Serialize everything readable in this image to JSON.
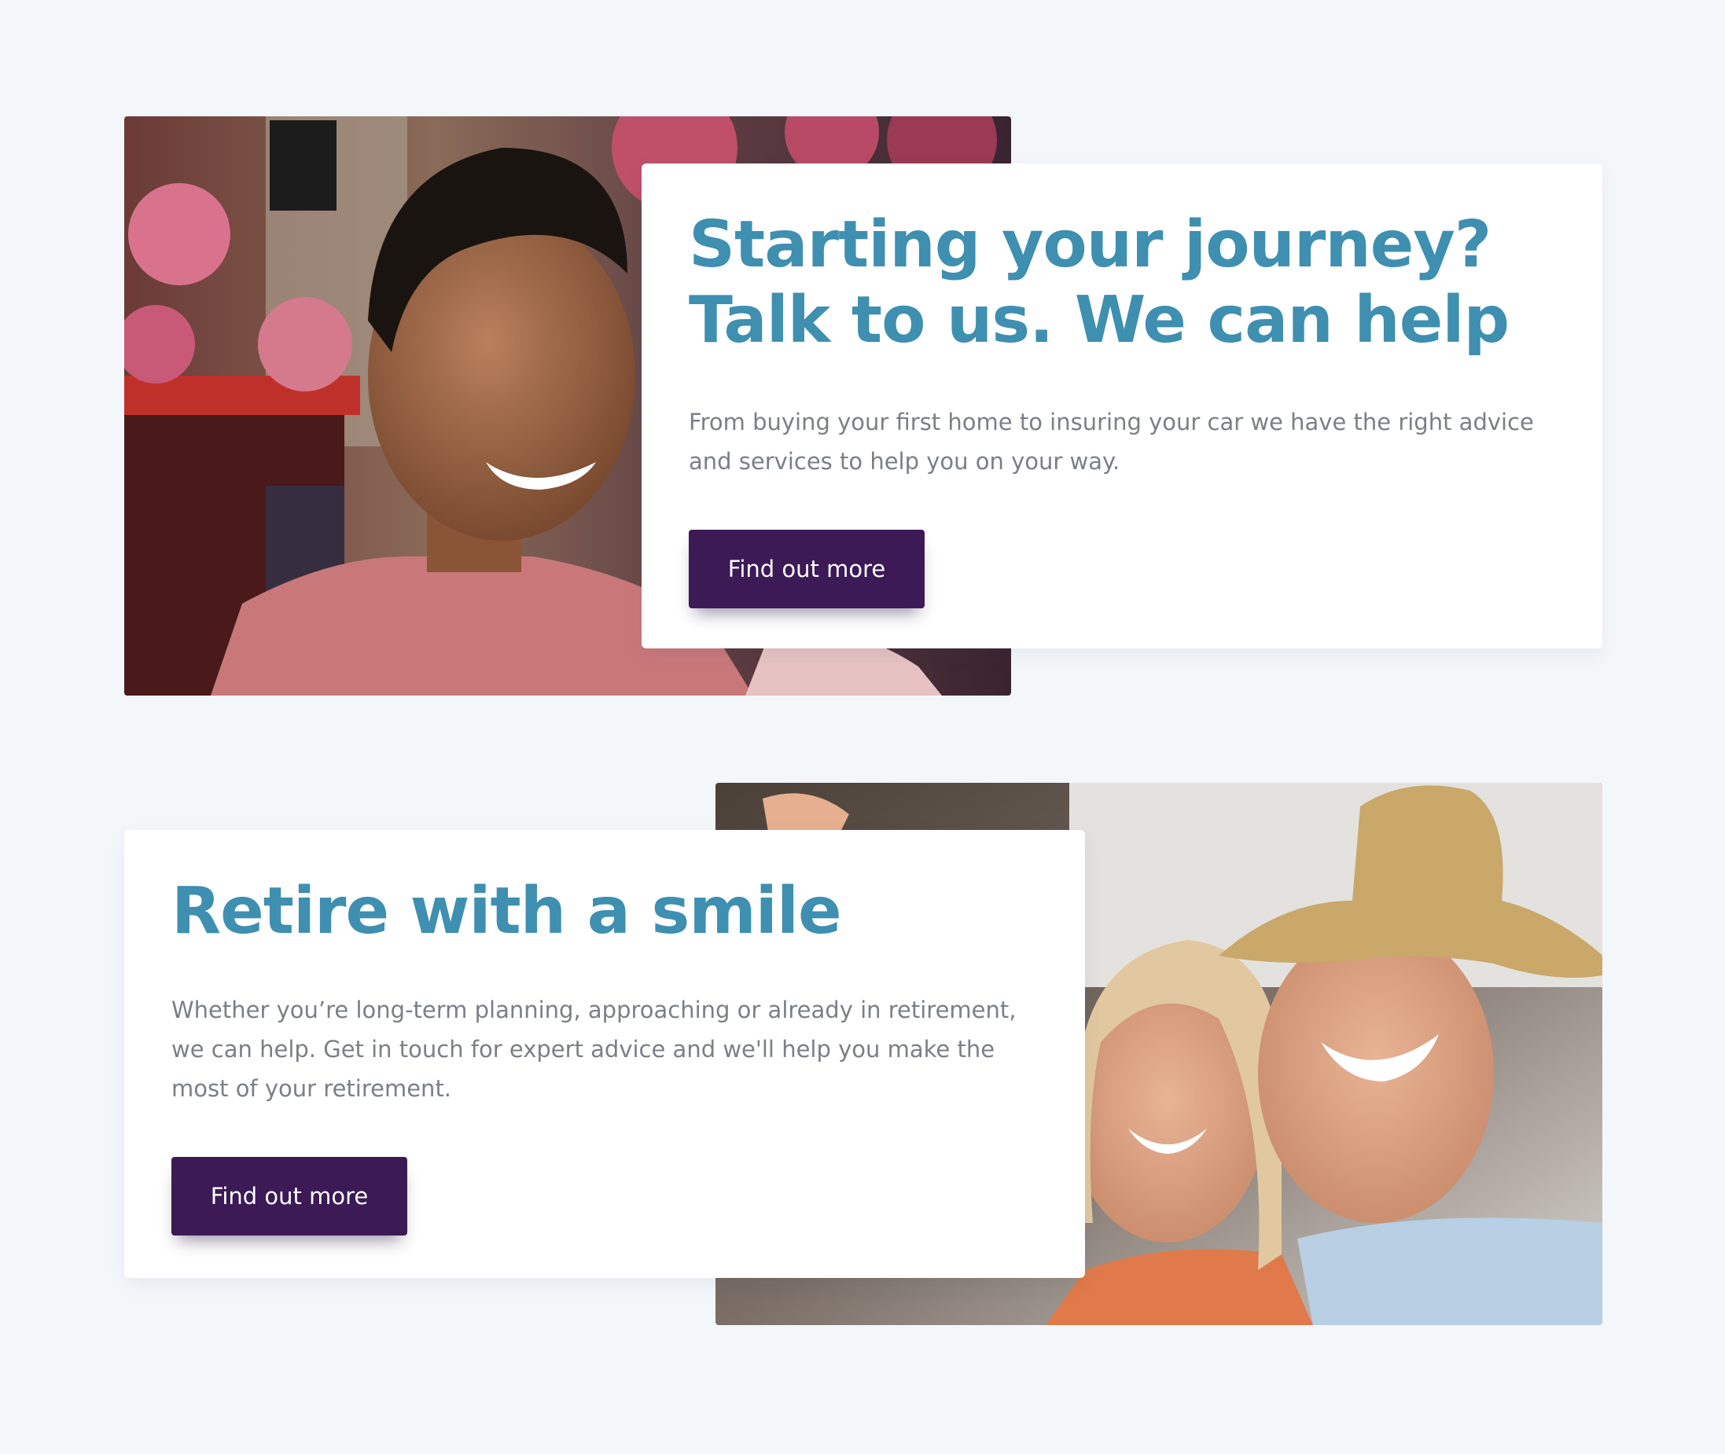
{
  "sections": [
    {
      "title": "Starting your journey? Talk to us. We can help",
      "body": "From buying your first home to insuring your car we have the right advice and services to help you on your way.",
      "button_label": "Find out more"
    },
    {
      "title": "Retire with a smile",
      "body": "Whether you’re long-term planning, approaching or already in retirement, we can help. Get in touch for expert advice and we'll help you make the most of your retirement.",
      "button_label": "Find out more"
    }
  ],
  "colors": {
    "background": "#f4f7fa",
    "heading": "#3e8fb0",
    "body_text": "#7b7f85",
    "button": "#3c1a55",
    "button_text": "#ffffff"
  }
}
